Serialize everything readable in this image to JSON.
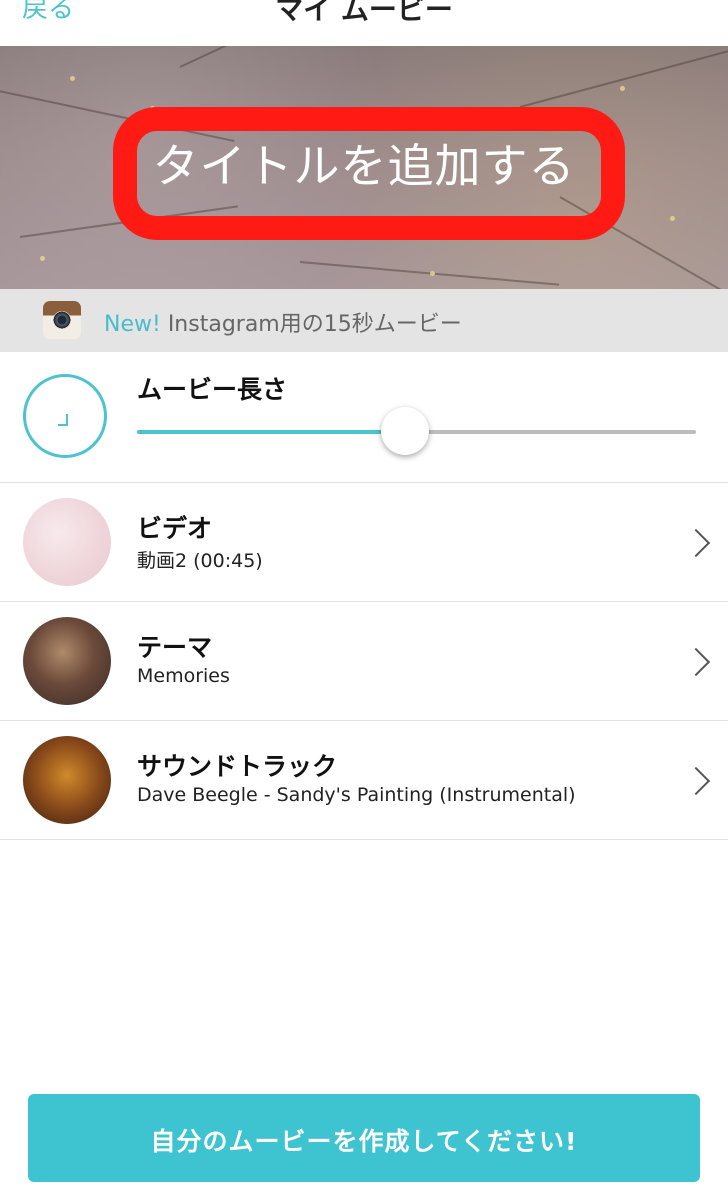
{
  "header": {
    "back_label": "戻る",
    "title": "マイ ムービー"
  },
  "banner": {
    "title_placeholder": "タイトルを追加する"
  },
  "instagram_promo": {
    "new_label": "New!",
    "text": "Instagram用の15秒ムービー"
  },
  "settings": {
    "length": {
      "label": "ムービー長さ",
      "slider_value": 0.48
    },
    "video": {
      "label": "ビデオ",
      "value": "動画2 (00:45)"
    },
    "theme": {
      "label": "テーマ",
      "value": "Memories"
    },
    "soundtrack": {
      "label": "サウンドトラック",
      "value": "Dave Beegle - Sandy's Painting (Instrumental)"
    }
  },
  "cta": {
    "label": "自分のムービーを作成してください!"
  },
  "colors": {
    "accent": "#4cc3cf",
    "cta": "#3ec3d0",
    "highlight": "#ff1a14"
  }
}
